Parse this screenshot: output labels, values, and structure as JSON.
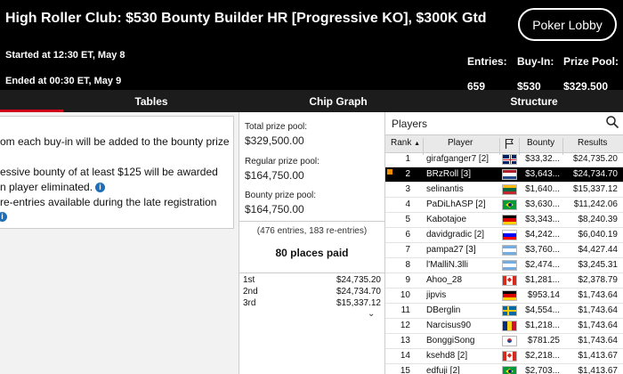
{
  "header": {
    "title": "High Roller Club: $530 Bounty Builder HR [Progressive KO], $300K Gtd",
    "started": "Started at 12:30 ET, May 8",
    "ended": "Ended at 00:30 ET, May 9",
    "lobby_button": "Poker Lobby",
    "entries_label": "Entries:",
    "entries_value": "659",
    "buyin_label": "Buy-In:",
    "buyin_value": "$530",
    "prize_label": "Prize Pool:",
    "prize_value": "$329,500"
  },
  "tabs": [
    "Tables",
    "Chip Graph",
    "Structure"
  ],
  "info": {
    "line1": "om each buy-in will be added to the bounty prize",
    "line2": "essive bounty of at least $125 will be awarded",
    "line3": "n player eliminated.",
    "line4": "re-entries available during the late registration",
    "info_icon": "i"
  },
  "prize": {
    "total_label": "Total prize pool:",
    "total_value": "$329,500.00",
    "regular_label": "Regular prize pool:",
    "regular_value": "$164,750.00",
    "bounty_label": "Bounty prize pool:",
    "bounty_value": "$164,750.00",
    "entries_note": "(476 entries, 183 re-entries)",
    "places_paid": "80 places paid",
    "payouts": [
      {
        "place": "1st",
        "amount": "$24,735.20"
      },
      {
        "place": "2nd",
        "amount": "$24,734.70"
      },
      {
        "place": "3rd",
        "amount": "$15,337.12"
      }
    ],
    "expand_glyph": "⌄"
  },
  "players": {
    "title": "Players",
    "columns": {
      "rank": "Rank",
      "sort": "▲",
      "player": "Player",
      "bounty": "Bounty",
      "results": "Results"
    },
    "rows": [
      {
        "rank": "1",
        "name": "girafganger7 [2]",
        "flag": "gb",
        "bounty": "$33,32...",
        "result": "$24,735.20"
      },
      {
        "rank": "2",
        "name": "BRzRoll [3]",
        "flag": "nl",
        "bounty": "$3,643...",
        "result": "$24,734.70"
      },
      {
        "rank": "3",
        "name": "selinantis",
        "flag": "lt",
        "bounty": "$1,640...",
        "result": "$15,337.12"
      },
      {
        "rank": "4",
        "name": "PaDiLhASP [2]",
        "flag": "br",
        "bounty": "$3,630...",
        "result": "$11,242.06"
      },
      {
        "rank": "5",
        "name": "Kabotajoe",
        "flag": "de",
        "bounty": "$3,343...",
        "result": "$8,240.39"
      },
      {
        "rank": "6",
        "name": "davidgradic [2]",
        "flag": "si",
        "bounty": "$4,242...",
        "result": "$6,040.19"
      },
      {
        "rank": "7",
        "name": "pampa27 [3]",
        "flag": "ar",
        "bounty": "$3,760...",
        "result": "$4,427.44"
      },
      {
        "rank": "8",
        "name": "l'MalliN.3lli",
        "flag": "ar",
        "bounty": "$2,474...",
        "result": "$3,245.31"
      },
      {
        "rank": "9",
        "name": "Ahoo_28",
        "flag": "ca",
        "bounty": "$1,281...",
        "result": "$2,378.79"
      },
      {
        "rank": "10",
        "name": "jipvis",
        "flag": "de",
        "bounty": "$953.14",
        "result": "$1,743.64"
      },
      {
        "rank": "11",
        "name": "DBerglin",
        "flag": "se",
        "bounty": "$4,554...",
        "result": "$1,743.64"
      },
      {
        "rank": "12",
        "name": "Narcisus90",
        "flag": "ro",
        "bounty": "$1,218...",
        "result": "$1,743.64"
      },
      {
        "rank": "13",
        "name": "BonggiSong",
        "flag": "kr",
        "bounty": "$781.25",
        "result": "$1,743.64"
      },
      {
        "rank": "14",
        "name": "ksehd8 [2]",
        "flag": "ca",
        "bounty": "$2,218...",
        "result": "$1,413.67"
      },
      {
        "rank": "15",
        "name": "edfuji [2]",
        "flag": "br",
        "bounty": "$2,703...",
        "result": "$1,413.67"
      }
    ],
    "selected_rank": "2"
  },
  "colors": {
    "accent": "#d0021b",
    "header_bg": "#000000",
    "marker": "#f28c00",
    "info_icon": "#1e6fb8"
  }
}
